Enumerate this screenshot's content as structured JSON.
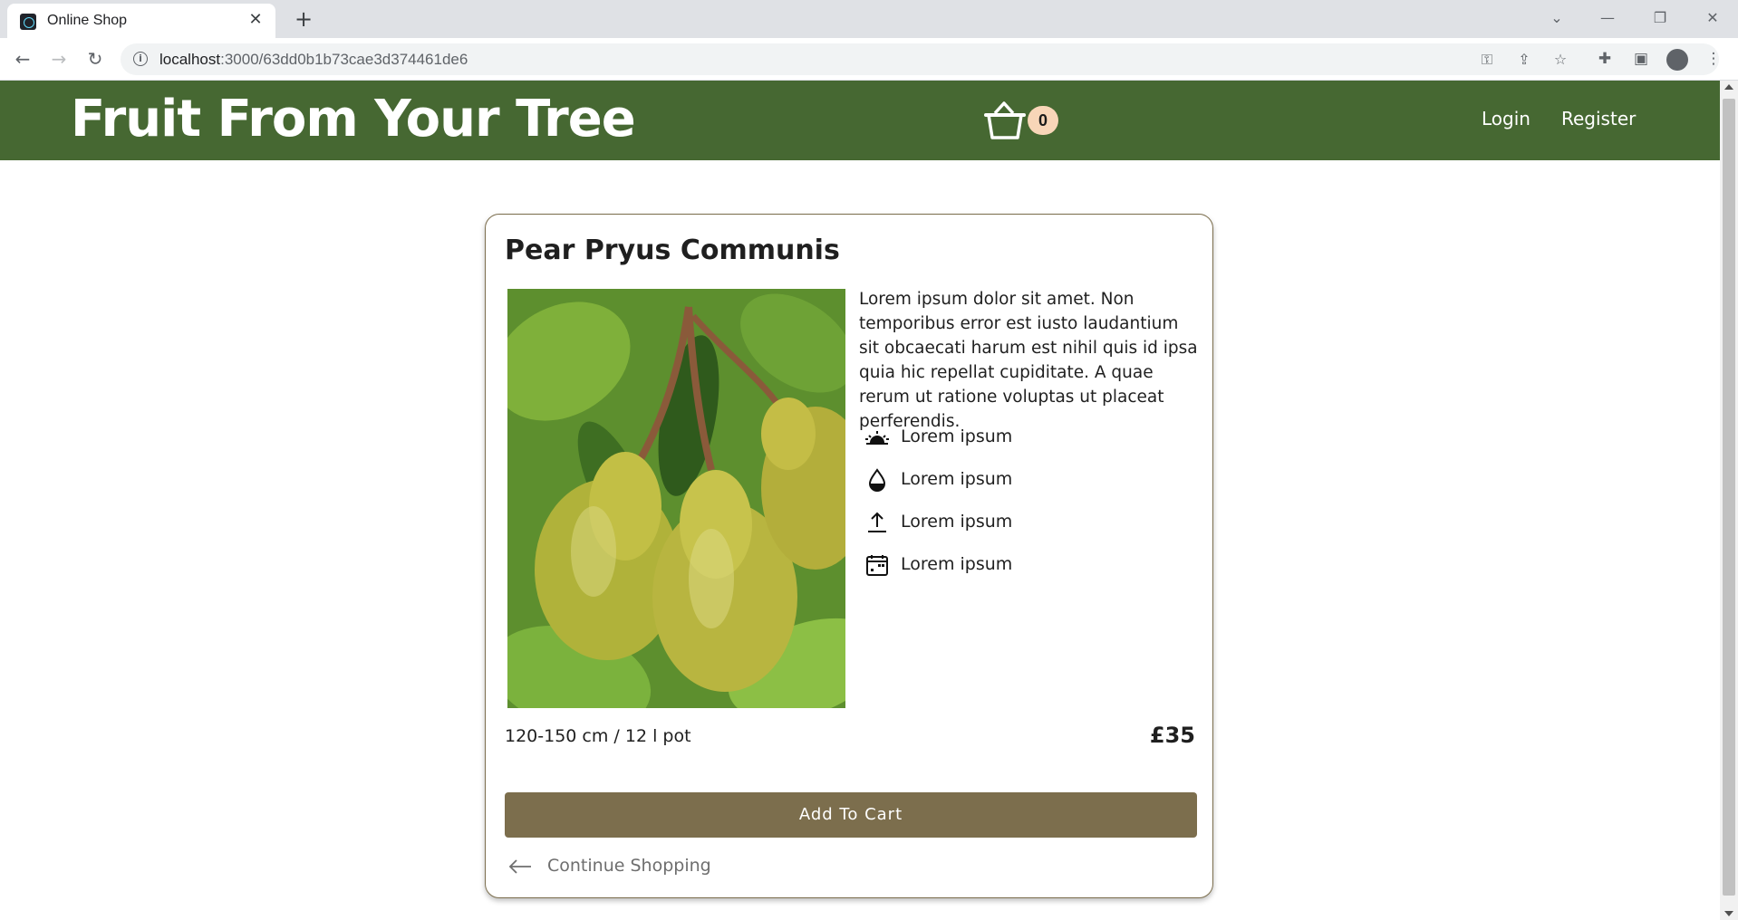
{
  "browser": {
    "tab_title": "Online Shop",
    "tab_close": "✕",
    "new_tab": "+",
    "url_host": "localhost",
    "url_path": ":3000/63dd0b1b73cae3d374461de6"
  },
  "header": {
    "brand": "Fruit From Your Tree",
    "cart_count": "0",
    "nav": {
      "login": "Login",
      "register": "Register"
    },
    "color": "#466832"
  },
  "product": {
    "title": "Pear Pryus Communis",
    "description": "Lorem ipsum dolor sit amet. Non temporibus error est iusto laudantium sit obcaecati harum est nihil quis id ipsa quia hic repellat cupiditate. A quae rerum ut ratione voluptas ut placeat perferendis.",
    "features": [
      {
        "icon": "sunrise-icon",
        "label": "Lorem ipsum"
      },
      {
        "icon": "water-drop-icon",
        "label": "Lorem ipsum"
      },
      {
        "icon": "upload-arrow-icon",
        "label": "Lorem ipsum"
      },
      {
        "icon": "calendar-icon",
        "label": "Lorem ipsum"
      }
    ],
    "size": "120-150 cm / 12 l pot",
    "price": "£35",
    "add_to_cart": "Add To Cart",
    "continue_shopping": "Continue Shopping",
    "button_color": "#7c6e4d"
  }
}
